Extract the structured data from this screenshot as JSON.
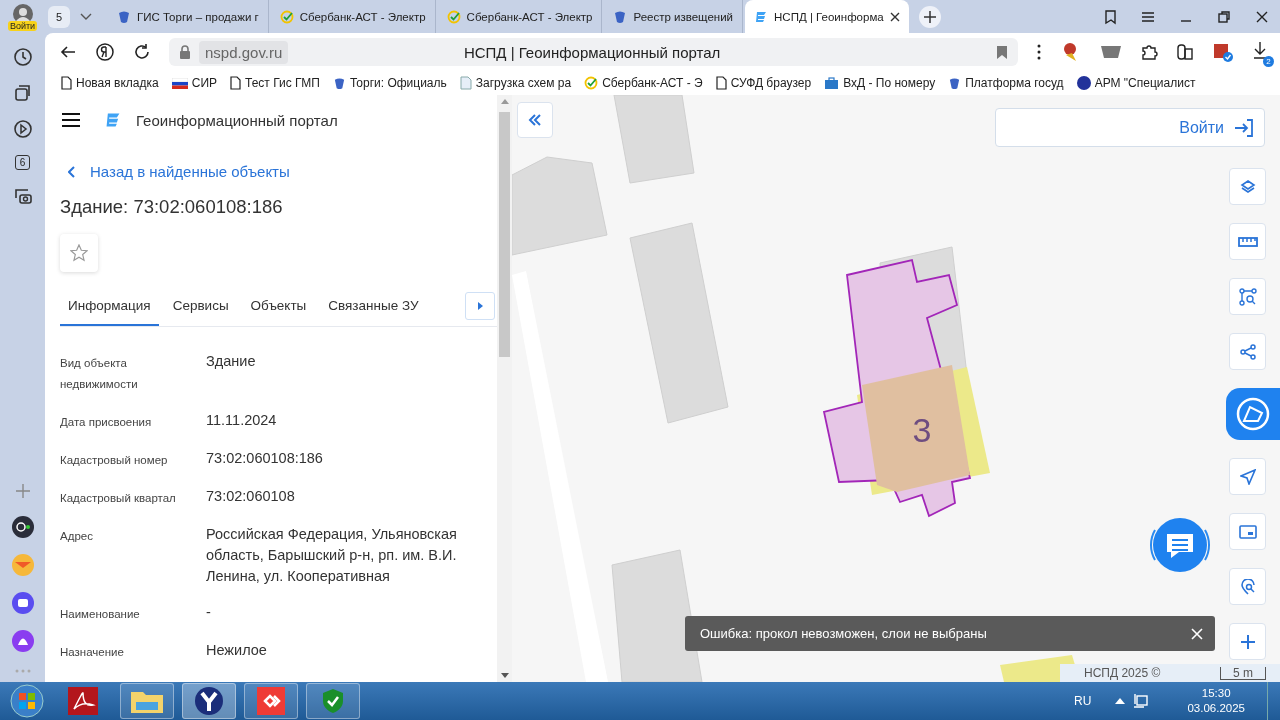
{
  "browser": {
    "profile_label": "Войти",
    "tab_count": "5",
    "sidebar_badge": "6",
    "tabs": [
      {
        "title": "ГИС Торги – продажи г",
        "selected": false
      },
      {
        "title": "Сбербанк-АСТ - Электр",
        "selected": false
      },
      {
        "title": "Сбербанк-АСТ - Электр",
        "selected": false
      },
      {
        "title": "Реестр извещений",
        "selected": false
      },
      {
        "title": "НСПД | Геоинформа",
        "selected": true
      }
    ],
    "address": "nspd.gov.ru",
    "page_title": "НСПД | Геоинформационный портал",
    "download_badge": "2",
    "bookmarks": [
      "Новая вкладка",
      "СИР",
      "Тест Гис ГМП",
      "Торги: Официаль",
      "Загрузка схем ра",
      "Сбербанк-АСТ - Э",
      "СУФД браузер",
      "ВхД - По номеру",
      "Платформа госуд",
      "АРМ \"Специалист"
    ]
  },
  "portal": {
    "title": "Геоинформационный портал",
    "back_link": "Назад в найденные объекты",
    "heading": "Здание: 73:02:060108:186",
    "tabs": [
      {
        "label": "Информация",
        "selected": true
      },
      {
        "label": "Сервисы",
        "selected": false
      },
      {
        "label": "Объекты",
        "selected": false
      },
      {
        "label": "Связанные ЗУ",
        "selected": false
      }
    ],
    "fields": [
      {
        "label": "Вид объекта недвижимости",
        "value": "Здание"
      },
      {
        "label": "Дата присвоения",
        "value": "11.11.2024"
      },
      {
        "label": "Кадастровый номер",
        "value": "73:02:060108:186"
      },
      {
        "label": "Кадастровый квартал",
        "value": "73:02:060108"
      },
      {
        "label": "Адрес",
        "value": "Российская Федерация, Ульяновская область, Барышский р-н, рп. им. В.И. Ленина, ул. Кооперативная"
      },
      {
        "label": "Наименование",
        "value": "-"
      },
      {
        "label": "Назначение",
        "value": "Нежилое"
      }
    ]
  },
  "map": {
    "login_button": "Войти",
    "building_label": "3",
    "toast": "Ошибка: прокол невозможен, слои не выбраны",
    "attribution": "НСПД 2025 ©",
    "scale": "5 m"
  },
  "taskbar": {
    "language": "RU",
    "time": "15:30",
    "date": "03.06.2025"
  }
}
